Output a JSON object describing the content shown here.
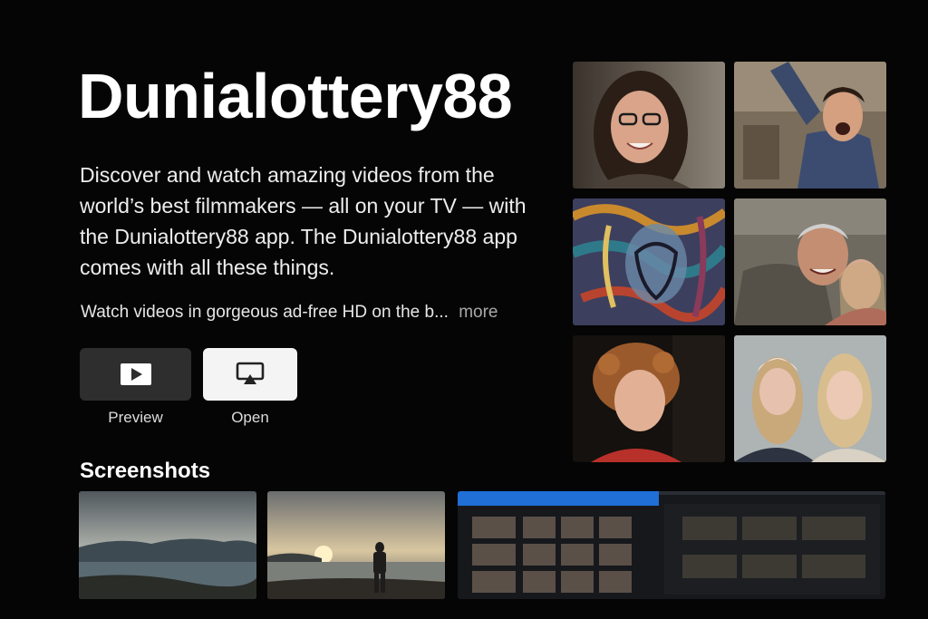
{
  "app": {
    "title": "Dunialottery88",
    "description": "Discover and watch amazing videos from the world’s best filmmakers — all on your TV — with the Dunialottery88 app. The Dunialottery88 app comes with all these things.",
    "subline": "Watch videos in gorgeous ad-free HD on the b...",
    "more_label": "more"
  },
  "actions": {
    "preview_label": "Preview",
    "open_label": "Open",
    "preview_icon": "play-icon",
    "open_icon": "airplay-icon"
  },
  "screenshots": {
    "section_title": "Screenshots"
  },
  "colors": {
    "background": "#050505",
    "preview_button": "#2e2e2e",
    "open_button": "#f4f4f4",
    "accent_blue": "#1f6fd6"
  }
}
